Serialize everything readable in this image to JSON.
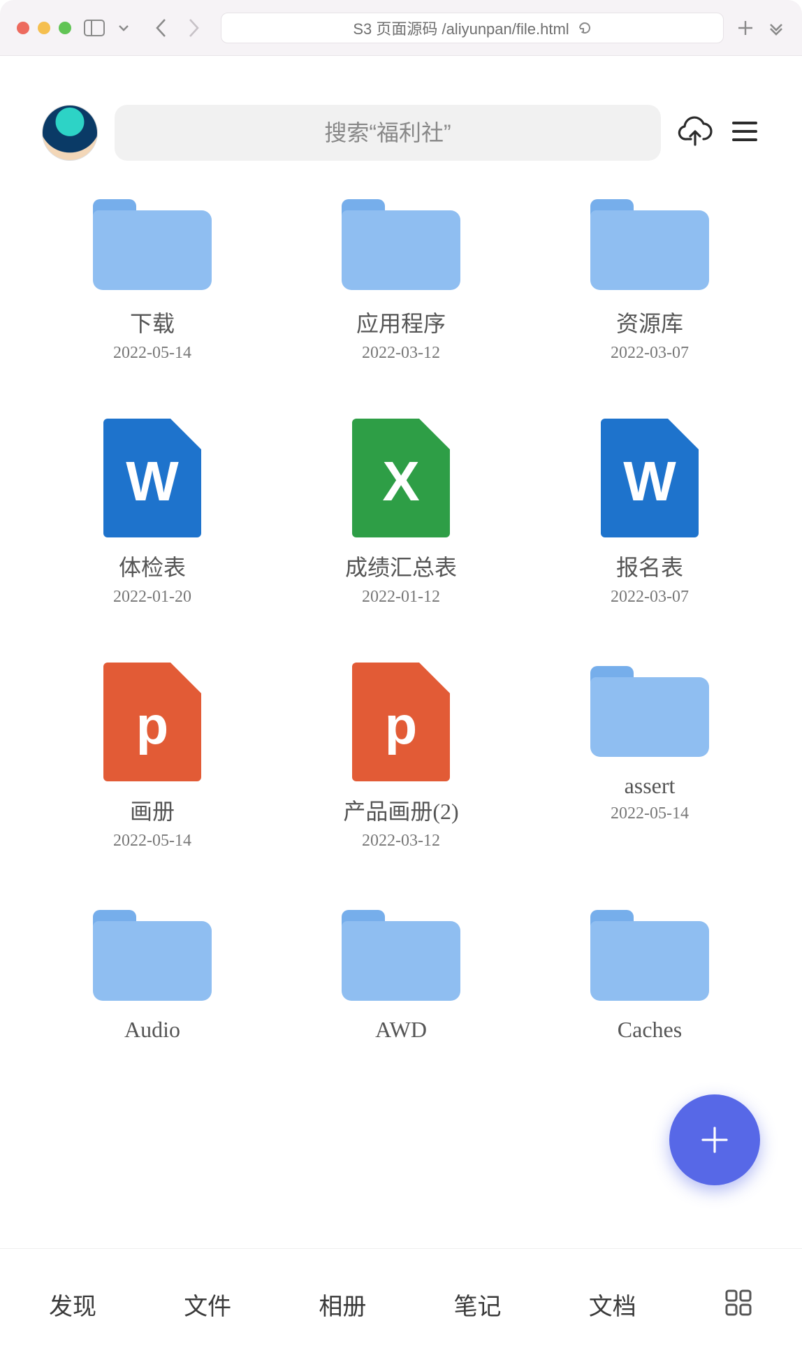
{
  "chrome": {
    "url_text": "S3 页面源码 /aliyunpan/file.html"
  },
  "header": {
    "search_placeholder": "搜索“福利社”"
  },
  "files": [
    {
      "name": "下载",
      "date": "2022-05-14",
      "kind": "folder"
    },
    {
      "name": "应用程序",
      "date": "2022-03-12",
      "kind": "folder"
    },
    {
      "name": "资源库",
      "date": "2022-03-07",
      "kind": "folder"
    },
    {
      "name": "体检表",
      "date": "2022-01-20",
      "kind": "word",
      "letter": "W"
    },
    {
      "name": "成绩汇总表",
      "date": "2022-01-12",
      "kind": "excel",
      "letter": "X"
    },
    {
      "name": "报名表",
      "date": "2022-03-07",
      "kind": "word",
      "letter": "W"
    },
    {
      "name": "画册",
      "date": "2022-05-14",
      "kind": "ppt",
      "letter": "p"
    },
    {
      "name": "产品画册(2)",
      "date": "2022-03-12",
      "kind": "ppt",
      "letter": "p"
    },
    {
      "name": "assert",
      "date": "2022-05-14",
      "kind": "folder"
    },
    {
      "name": "Audio",
      "date": "",
      "kind": "folder"
    },
    {
      "name": "AWD",
      "date": "",
      "kind": "folder"
    },
    {
      "name": "Caches",
      "date": "",
      "kind": "folder"
    }
  ],
  "tabs": [
    "发现",
    "文件",
    "相册",
    "笔记",
    "文档"
  ]
}
